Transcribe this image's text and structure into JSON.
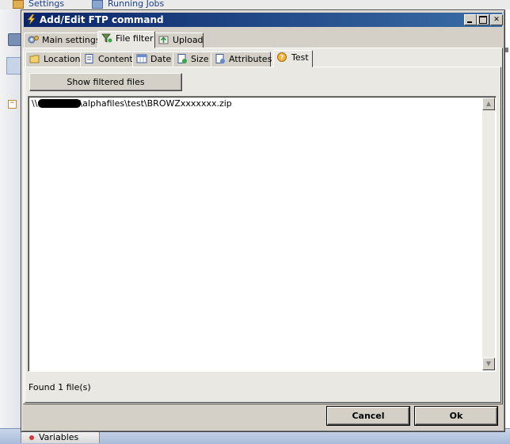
{
  "background": {
    "toolbar_tabs": [
      {
        "label": "Settings"
      },
      {
        "label": "Running Jobs"
      }
    ],
    "bottom_tab": "Variables"
  },
  "dialog": {
    "title": "Add/Edit FTP command",
    "outer_tabs": [
      {
        "label": "Main settings",
        "icon": "gears-icon"
      },
      {
        "label": "File filter",
        "icon": "filter-icon",
        "active": true
      },
      {
        "label": "Upload",
        "icon": "upload-icon"
      }
    ],
    "inner_tabs": [
      {
        "label": "Location",
        "icon": "folder-icon"
      },
      {
        "label": "Content",
        "icon": "document-icon"
      },
      {
        "label": "Date",
        "icon": "calendar-icon"
      },
      {
        "label": "Size",
        "icon": "size-icon"
      },
      {
        "label": "Attributes",
        "icon": "attributes-icon"
      },
      {
        "label": "Test",
        "icon": "help-icon",
        "active": true
      }
    ],
    "show_button": "Show filtered files",
    "results": [
      {
        "prefix": "\\\\",
        "suffix": "\\alphafiles\\test\\BROWZxxxxxxx.zip"
      }
    ],
    "status": "Found 1 file(s)",
    "cancel_label": "Cancel",
    "ok_label": "Ok",
    "colors": {
      "title_start": "#0a246a",
      "title_end": "#3a6ea5",
      "face": "#d4d0c8",
      "panel": "#e9e8e2"
    }
  }
}
